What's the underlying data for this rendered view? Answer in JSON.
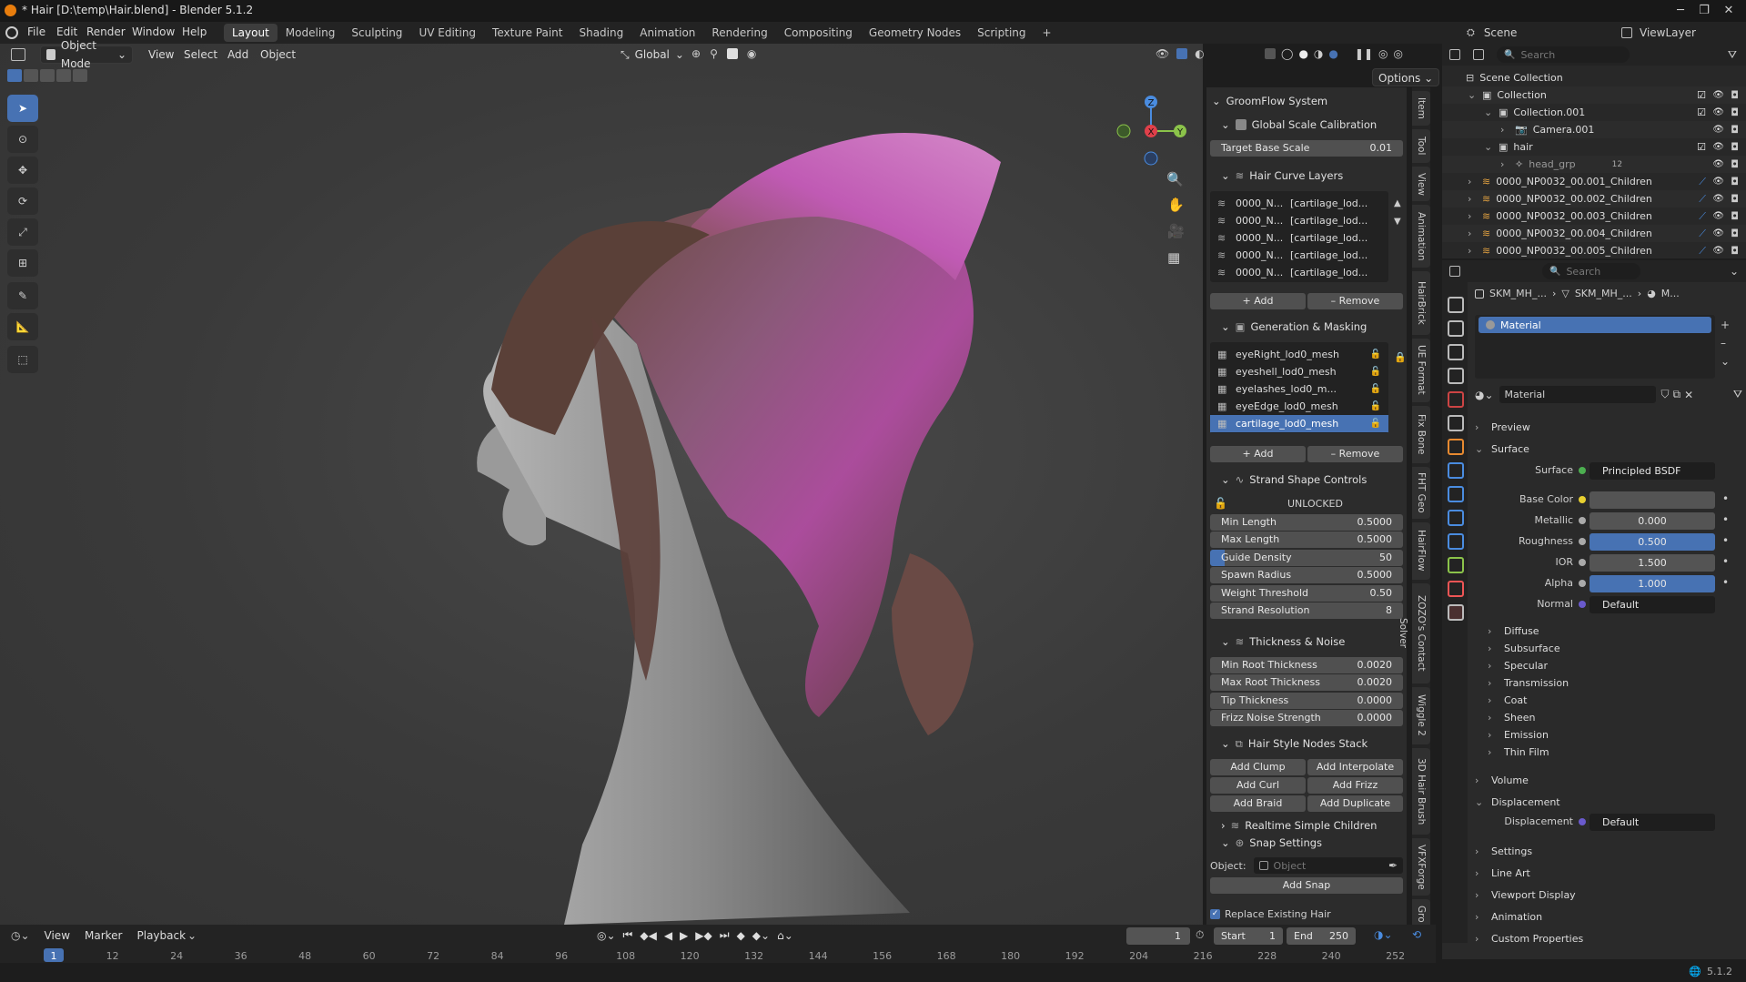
{
  "window": {
    "title": "* Hair [D:\\temp\\Hair.blend] - Blender 5.1.2"
  },
  "menu": [
    "File",
    "Edit",
    "Render",
    "Window",
    "Help"
  ],
  "workspaces": [
    "Layout",
    "Modeling",
    "Sculpting",
    "UV Editing",
    "Texture Paint",
    "Shading",
    "Animation",
    "Rendering",
    "Compositing",
    "Geometry Nodes",
    "Scripting"
  ],
  "active_workspace": "Layout",
  "viewport": {
    "mode": "Object Mode",
    "menus": [
      "View",
      "Select",
      "Add",
      "Object"
    ],
    "transform_orientation": "Global",
    "options_label": "Options"
  },
  "gizmo": {
    "x": "X",
    "y": "Y",
    "z": "Z"
  },
  "npanel": {
    "system_title": "GroomFlow System",
    "global_scale": {
      "title": "Global Scale Calibration",
      "label": "Target Base Scale",
      "value": "0.01"
    },
    "hair_curve_layers": {
      "title": "Hair Curve Layers",
      "items": [
        {
          "name": "0000_N...",
          "mask": "[cartilage_lod..."
        },
        {
          "name": "0000_N...",
          "mask": "[cartilage_lod..."
        },
        {
          "name": "0000_N...",
          "mask": "[cartilage_lod..."
        },
        {
          "name": "0000_N...",
          "mask": "[cartilage_lod..."
        },
        {
          "name": "0000_N...",
          "mask": "[cartilage_lod..."
        }
      ],
      "add": "Add",
      "remove": "Remove"
    },
    "generation_masking": {
      "title": "Generation & Masking",
      "items": [
        "eyeRight_lod0_mesh",
        "eyeshell_lod0_mesh",
        "eyelashes_lod0_m...",
        "eyeEdge_lod0_mesh",
        "cartilage_lod0_mesh"
      ],
      "selected_index": 4,
      "add": "Add",
      "remove": "Remove"
    },
    "strand_shape": {
      "title": "Strand Shape Controls",
      "lock_state": "UNLOCKED",
      "fields": [
        {
          "label": "Min Length",
          "value": "0.5000"
        },
        {
          "label": "Max Length",
          "value": "0.5000"
        },
        {
          "label": "Guide Density",
          "value": "50"
        },
        {
          "label": "Spawn Radius",
          "value": "0.5000"
        },
        {
          "label": "Weight Threshold",
          "value": "0.50"
        },
        {
          "label": "Strand Resolution",
          "value": "8"
        }
      ]
    },
    "thickness_noise": {
      "title": "Thickness & Noise",
      "fields": [
        {
          "label": "Min Root Thickness",
          "value": "0.0020"
        },
        {
          "label": "Max Root Thickness",
          "value": "0.0020"
        },
        {
          "label": "Tip Thickness",
          "value": "0.0000"
        },
        {
          "label": "Frizz Noise Strength",
          "value": "0.0000"
        }
      ]
    },
    "hair_style_nodes": {
      "title": "Hair Style Nodes Stack",
      "buttons": [
        "Add Clump",
        "Add Interpolate",
        "Add Curl",
        "Add Frizz",
        "Add Braid",
        "Add Duplicate"
      ]
    },
    "realtime_children": "Realtime Simple Children",
    "snap_settings": {
      "title": "Snap Settings",
      "object_label": "Object:",
      "object_placeholder": "Object",
      "add_snap": "Add Snap"
    },
    "replace_existing": "Replace Existing Hair"
  },
  "vtabs": [
    "Item",
    "Tool",
    "View",
    "Animation",
    "HairBrick",
    "UE Format",
    "Fix Bone",
    "FHT Geo",
    "HairFlow",
    "ZOZO's Contact Solver",
    "Wiggle 2",
    "3D Hair Brush",
    "VFXForge",
    "Gro"
  ],
  "outliner": {
    "search_placeholder": "Search",
    "scene": "Scene",
    "view_layer": "ViewLayer",
    "rows": [
      {
        "label": "Scene Collection",
        "indent": 0
      },
      {
        "label": "Collection",
        "indent": 1
      },
      {
        "label": "Collection.001",
        "indent": 2
      },
      {
        "label": "Camera.001",
        "indent": 3
      },
      {
        "label": "hair",
        "indent": 2
      },
      {
        "label": "head_grp",
        "indent": 3
      },
      {
        "label": "0000_NP0032_00.001_Children",
        "indent": 1
      },
      {
        "label": "0000_NP0032_00.002_Children",
        "indent": 1
      },
      {
        "label": "0000_NP0032_00.003_Children",
        "indent": 1
      },
      {
        "label": "0000_NP0032_00.004_Children",
        "indent": 1
      },
      {
        "label": "0000_NP0032_00.005_Children",
        "indent": 1
      }
    ],
    "head_grp_count": "12"
  },
  "properties": {
    "search_placeholder": "Search",
    "breadcrumb": [
      "SKM_MH_...",
      "SKM_MH_...",
      "M..."
    ],
    "slot": "Material",
    "material_name": "Material",
    "sections": {
      "preview": "Preview",
      "surface": "Surface",
      "surface_label": "Surface",
      "surface_value": "Principled BSDF",
      "fields": [
        {
          "label": "Base Color",
          "value": "",
          "fill": 0
        },
        {
          "label": "Metallic",
          "value": "0.000",
          "fill": 0
        },
        {
          "label": "Roughness",
          "value": "0.500",
          "fill": 1
        },
        {
          "label": "IOR",
          "value": "1.500",
          "fill": 0
        },
        {
          "label": "Alpha",
          "value": "1.000",
          "fill": 1
        }
      ],
      "normal_label": "Normal",
      "normal_value": "Default",
      "subs": [
        "Diffuse",
        "Subsurface",
        "Specular",
        "Transmission",
        "Coat",
        "Sheen",
        "Emission",
        "Thin Film"
      ],
      "volume": "Volume",
      "displacement": "Displacement",
      "displacement_label": "Displacement",
      "displacement_value": "Default",
      "tail": [
        "Settings",
        "Line Art",
        "Viewport Display",
        "Animation",
        "Custom Properties"
      ]
    }
  },
  "timeline": {
    "menus": [
      "View",
      "Marker",
      "Playback"
    ],
    "current_frame": "1",
    "start_label": "Start",
    "start": "1",
    "end_label": "End",
    "end": "250",
    "ticks": [
      "1",
      "12",
      "24",
      "36",
      "48",
      "60",
      "72",
      "84",
      "96",
      "108",
      "120",
      "132",
      "144",
      "156",
      "168",
      "180",
      "192",
      "204",
      "216",
      "228",
      "240",
      "252"
    ]
  },
  "status": {
    "version": "5.1.2"
  },
  "colors": {
    "accent": "#4772b3",
    "hair_purple": "#a0408f",
    "x_axis": "#e0404a",
    "y_axis": "#8bc34a",
    "z_axis": "#4a8ce0"
  }
}
